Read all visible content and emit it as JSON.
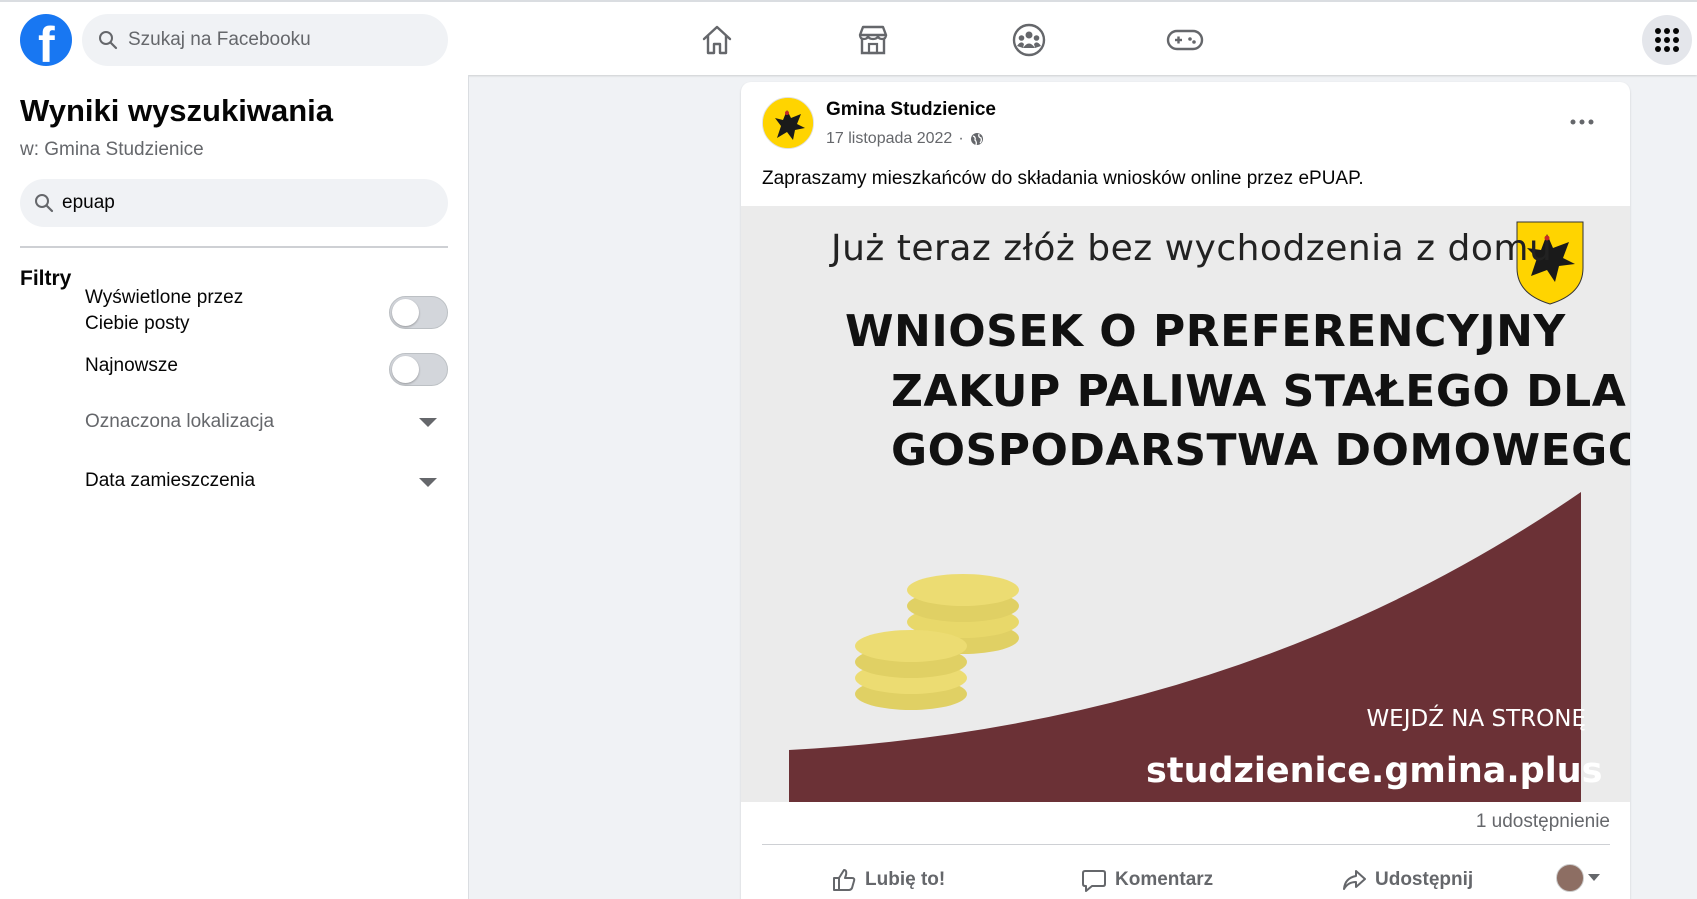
{
  "topbar": {
    "logo_letter": "f",
    "search_placeholder": "Szukaj na Facebooku",
    "nav_icons": [
      "home-icon",
      "marketplace-icon",
      "groups-icon",
      "gaming-icon"
    ],
    "menu_icon": "grid-menu-icon"
  },
  "left": {
    "title": "Wyniki wyszukiwania",
    "subtitle": "w: Gmina Studzienice",
    "search_value": "epuap",
    "filters_title": "Filtry",
    "filters": {
      "seen_posts": "Wyświetlone przez Ciebie posty",
      "seen_posts_on": false,
      "newest": "Najnowsze",
      "newest_on": false,
      "location": "Oznaczona lokalizacja",
      "date": "Data zamieszczenia"
    }
  },
  "post": {
    "author": "Gmina Studzienice",
    "date": "17 listopada 2022",
    "privacy_icon": "globe-icon",
    "text": "Zapraszamy mieszkańców do składania wniosków online przez ePUAP.",
    "image": {
      "tagline": "Już teraz złóż bez wychodzenia z domu",
      "headline_1": "WNIOSEK O PREFERENCYJNY",
      "headline_2": "ZAKUP PALIWA STAŁEGO DLA",
      "headline_3": "GOSPODARSTWA DOMOWEGO",
      "cta": "WEJDŹ NA STRONĘ",
      "url": "studzienice.gmina.plus",
      "colors": {
        "maroon": "#6b3136",
        "coin": "#e8d86a",
        "background": "#ebebeb"
      }
    },
    "shares": "1 udostępnienie",
    "actions": {
      "like": "Lubię to!",
      "comment": "Komentarz",
      "share": "Udostępnij"
    }
  },
  "colors": {
    "brand": "#1877f2",
    "muted": "#65676b"
  }
}
